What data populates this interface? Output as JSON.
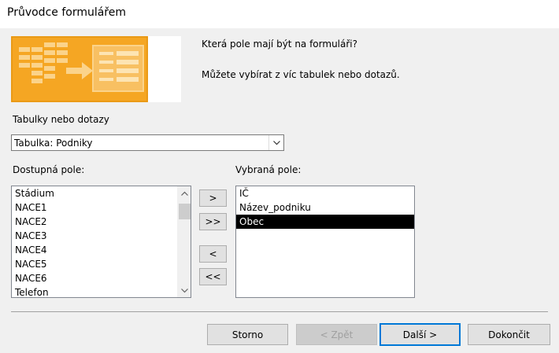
{
  "window": {
    "title": "Průvodce formulářem"
  },
  "header": {
    "question": "Která pole mají být na formuláři?",
    "hint": "Můžete vybírat z víc tabulek nebo dotazů."
  },
  "source": {
    "label": "Tabulky nebo dotazy",
    "selected": "Tabulka: Podniky"
  },
  "available": {
    "label": "Dostupná pole:",
    "items": [
      "Stádium",
      "NACE1",
      "NACE2",
      "NACE3",
      "NACE4",
      "NACE5",
      "NACE6",
      "Telefon"
    ]
  },
  "selected_fields": {
    "label": "Vybraná pole:",
    "items": [
      "IČ",
      "Název_podniku",
      "Obec"
    ],
    "highlighted": "Obec"
  },
  "move_buttons": {
    "add_one": ">",
    "add_all": ">>",
    "remove_one": "<",
    "remove_all": "<<"
  },
  "footer": {
    "cancel": "Storno",
    "back": "< Zpět",
    "next": "Další >",
    "finish": "Dokončit"
  },
  "colors": {
    "accent": "#0078d7",
    "image_orange": "#f5a623",
    "selection": "#000000"
  }
}
